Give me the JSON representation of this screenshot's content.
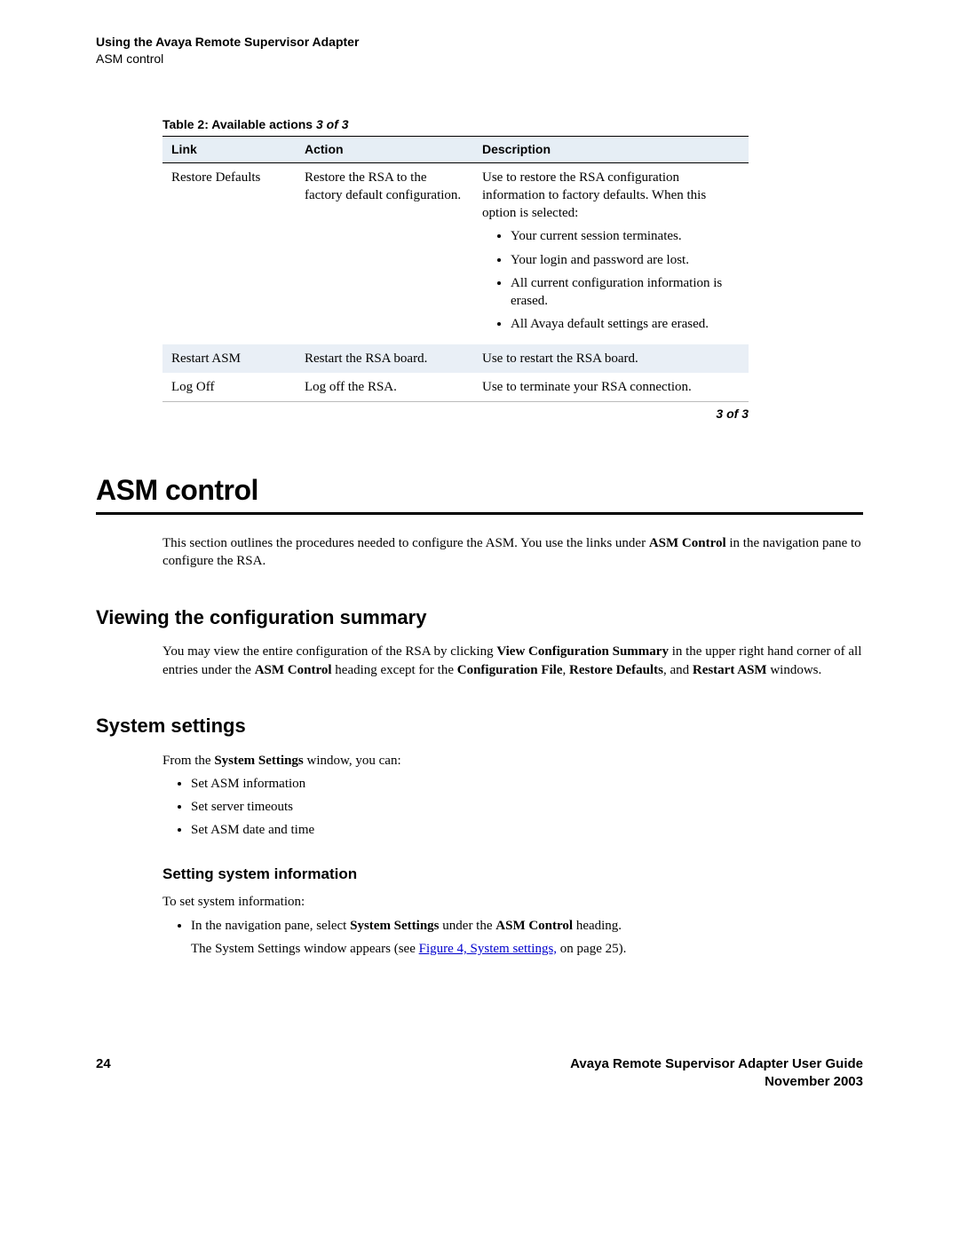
{
  "header": {
    "title": "Using the Avaya Remote Supervisor Adapter",
    "section": "ASM control"
  },
  "table": {
    "caption_prefix": "Table 2: Available actions  ",
    "caption_page": "3 of 3",
    "head": {
      "c0": "Link",
      "c1": "Action",
      "c2": "Description"
    },
    "r0": {
      "link": "Restore Defaults",
      "action": "Restore the RSA to the factory default configuration.",
      "desc_intro": "Use to restore the RSA configuration information to factory defaults. When this option is selected:",
      "b0": "Your current session terminates.",
      "b1": "Your login and password are lost.",
      "b2": "All current configuration information is erased.",
      "b3": "All Avaya default settings are erased."
    },
    "r1": {
      "link": "Restart ASM",
      "action": "Restart the RSA board.",
      "desc": "Use to restart the RSA board."
    },
    "r2": {
      "link": "Log Off",
      "action": "Log off the RSA.",
      "desc": "Use to terminate your RSA connection."
    },
    "tail": "3 of 3"
  },
  "h1": "ASM control",
  "intro": {
    "p_a": "This section outlines the procedures needed to configure the ASM. You use the links under ",
    "p_bold": "ASM Control",
    "p_b": " in the navigation pane to configure the RSA."
  },
  "h2a": "Viewing the configuration summary",
  "view_cfg": {
    "s0": "You may view the entire configuration of the RSA by clicking ",
    "b0": "View Configuration Summary",
    "s1": " in the upper right hand corner of all entries under the ",
    "b1": "ASM Control",
    "s2": " heading except for the ",
    "b2": "Configuration File",
    "s3": ", ",
    "b3": "Restore Defaults",
    "s4": ", and ",
    "b4": "Restart ASM",
    "s5": " windows."
  },
  "h2b": "System settings",
  "sys_settings": {
    "intro_a": "From the ",
    "intro_bold": "System Settings",
    "intro_b": " window, you can:",
    "b0": "Set ASM information",
    "b1": "Set server timeouts",
    "b2": "Set ASM date and time"
  },
  "h3a": "Setting system information",
  "set_info": {
    "lead": "To set system information:",
    "step_a": "In the navigation pane, select ",
    "step_bold1": "System Settings",
    "step_mid": " under the ",
    "step_bold2": "ASM Control",
    "step_end": " heading.",
    "sub_a": "The System Settings window appears (see ",
    "sub_link": "Figure 4, System settings,",
    "sub_b": " on page 25)."
  },
  "footer": {
    "page": "24",
    "title": "Avaya Remote Supervisor Adapter User Guide",
    "date": "November 2003"
  }
}
